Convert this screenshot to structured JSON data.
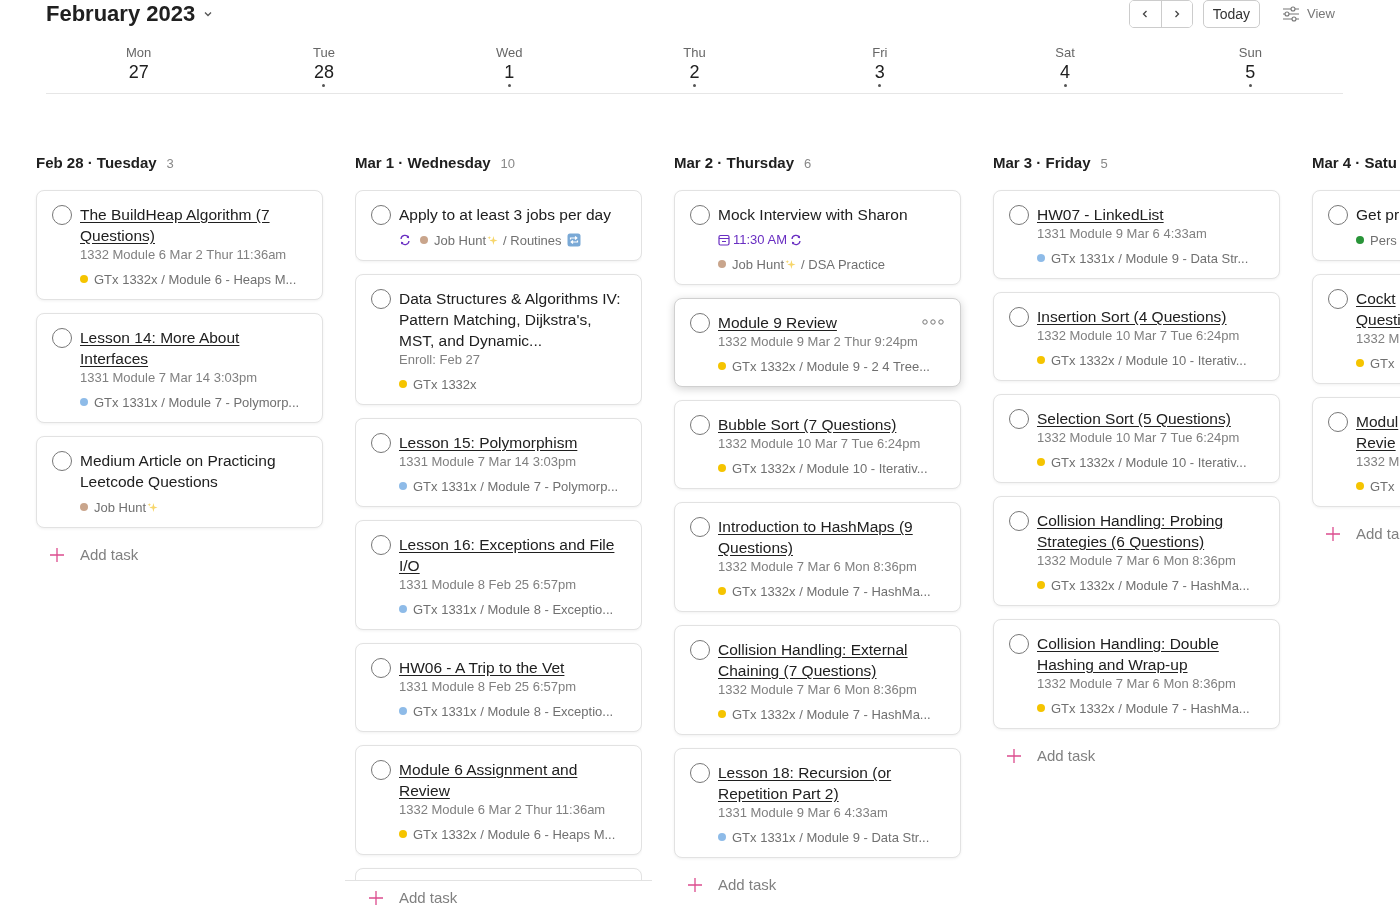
{
  "header": {
    "title": "February 2023",
    "nav": {
      "today": "Today",
      "view": "View"
    }
  },
  "week": [
    {
      "name": "Mon",
      "number": "27",
      "has_tasks": false
    },
    {
      "name": "Tue",
      "number": "28",
      "has_tasks": true
    },
    {
      "name": "Wed",
      "number": "1",
      "has_tasks": true
    },
    {
      "name": "Thu",
      "number": "2",
      "has_tasks": true
    },
    {
      "name": "Fri",
      "number": "3",
      "has_tasks": true
    },
    {
      "name": "Sat",
      "number": "4",
      "has_tasks": true
    },
    {
      "name": "Sun",
      "number": "5",
      "has_tasks": true
    }
  ],
  "columns": [
    {
      "heading": "Feb 28 · Tuesday",
      "count": "3",
      "scrolled": false,
      "add_task": "Add task",
      "tasks": [
        {
          "title": "The BuildHeap Algorithm (7 Questions)",
          "link": true,
          "completed": false,
          "hovered": false,
          "description": "1332 Module 6 Mar 2 Thur 11:36am",
          "project": {
            "name": "GTx 1332x / Module 6 - Heaps M...",
            "color": "#f5c400"
          }
        },
        {
          "title": "Lesson 14: More About Interfaces",
          "link": true,
          "completed": false,
          "hovered": false,
          "description": "1331 Module 7 Mar 14 3:03pm",
          "project": {
            "name": "GTx 1331x / Module 7 - Polymorp...",
            "color": "#8ebbe8"
          }
        },
        {
          "title": "Medium Article on Practicing Leetcode Questions",
          "link": false,
          "completed": false,
          "hovered": false,
          "project": {
            "name": "Job Hunt",
            "sparkle": true,
            "color": "#c9a58c"
          }
        }
      ]
    },
    {
      "heading": "Mar 1 · Wednesday",
      "count": "10",
      "scrolled": true,
      "add_task": "Add task",
      "tasks": [
        {
          "title": "Apply to at least 3 jobs per day",
          "link": false,
          "completed": false,
          "hovered": false,
          "recurring": true,
          "project": {
            "name": "Job Hunt",
            "sparkle": true,
            "section": "/ Routines",
            "section_icon": true,
            "color": "#c9a58c"
          }
        },
        {
          "title": "Data Structures & Algorithms IV: Pattern Matching, Dijkstra's, MST, and Dynamic...",
          "link": false,
          "completed": false,
          "hovered": false,
          "description": "Enroll: Feb 27",
          "project": {
            "name": "GTx 1332x",
            "color": "#f5c400"
          }
        },
        {
          "title": "Lesson 15: Polymorphism",
          "link": true,
          "completed": false,
          "hovered": false,
          "description": "1331 Module 7 Mar 14 3:03pm",
          "project": {
            "name": "GTx 1331x / Module 7 - Polymorp...",
            "color": "#8ebbe8"
          }
        },
        {
          "title": "Lesson 16: Exceptions and File I/O",
          "link": true,
          "completed": false,
          "hovered": false,
          "description": "1331 Module 8 Feb 25 6:57pm",
          "project": {
            "name": "GTx 1331x / Module 8 - Exceptio...",
            "color": "#8ebbe8"
          }
        },
        {
          "title": "HW06 - A Trip to the Vet",
          "link": true,
          "completed": false,
          "hovered": false,
          "description": "1331 Module 8 Feb 25 6:57pm",
          "project": {
            "name": "GTx 1331x / Module 8 - Exceptio...",
            "color": "#8ebbe8"
          }
        },
        {
          "title": "Module 6 Assignment and Review",
          "link": true,
          "completed": false,
          "hovered": false,
          "description": "1332 Module 6 Mar 2 Thur 11:36am",
          "project": {
            "name": "GTx 1332x / Module 6 - Heaps M...",
            "color": "#f5c400"
          }
        }
      ]
    },
    {
      "heading": "Mar 2 · Thursday",
      "count": "6",
      "scrolled": false,
      "add_task": "Add task",
      "tasks": [
        {
          "title": "Mock Interview with Sharon",
          "link": false,
          "completed": false,
          "hovered": false,
          "time": "11:30 AM",
          "recurring": true,
          "project": {
            "name": "Job Hunt",
            "sparkle": true,
            "section": "/ DSA Practice",
            "color": "#c9a58c"
          }
        },
        {
          "title": "Module 9 Review",
          "link": true,
          "completed": false,
          "hovered": true,
          "description": "1332 Module 9 Mar 2 Thur 9:24pm",
          "project": {
            "name": "GTx 1332x / Module 9 - 2 4 Tree...",
            "color": "#f5c400"
          }
        },
        {
          "title": "Bubble Sort (7 Questions)",
          "link": true,
          "completed": false,
          "hovered": false,
          "description": "1332 Module 10 Mar 7 Tue 6:24pm",
          "project": {
            "name": "GTx 1332x / Module 10 - Iterativ...",
            "color": "#f5c400"
          }
        },
        {
          "title": "Introduction to HashMaps (9 Questions)",
          "link": true,
          "completed": false,
          "hovered": false,
          "description": "1332 Module 7 Mar 6 Mon 8:36pm",
          "project": {
            "name": "GTx 1332x / Module 7 - HashMa...",
            "color": "#f5c400"
          }
        },
        {
          "title": "Collision Handling: External Chaining (7 Questions)",
          "link": true,
          "completed": false,
          "hovered": false,
          "description": "1332 Module 7 Mar 6 Mon 8:36pm",
          "project": {
            "name": "GTx 1332x / Module 7 - HashMa...",
            "color": "#f5c400"
          }
        },
        {
          "title": "Lesson 18: Recursion (or Repetition Part 2)",
          "link": true,
          "completed": false,
          "hovered": false,
          "description": "1331 Module 9 Mar 6 4:33am",
          "project": {
            "name": "GTx 1331x / Module 9 - Data Str...",
            "color": "#8ebbe8"
          }
        }
      ]
    },
    {
      "heading": "Mar 3 · Friday",
      "count": "5",
      "scrolled": false,
      "add_task": "Add task",
      "tasks": [
        {
          "title": "HW07 - LinkedList",
          "link": true,
          "completed": false,
          "hovered": false,
          "description": "1331 Module 9 Mar 6 4:33am",
          "project": {
            "name": "GTx 1331x / Module 9 - Data Str...",
            "color": "#8ebbe8"
          }
        },
        {
          "title": "Insertion Sort (4 Questions)",
          "link": true,
          "completed": false,
          "hovered": false,
          "description": "1332 Module 10 Mar 7 Tue 6:24pm",
          "project": {
            "name": "GTx 1332x / Module 10 - Iterativ...",
            "color": "#f5c400"
          }
        },
        {
          "title": "Selection Sort (5 Questions)",
          "link": true,
          "completed": false,
          "hovered": false,
          "description": "1332 Module 10 Mar 7 Tue 6:24pm",
          "project": {
            "name": "GTx 1332x / Module 10 - Iterativ...",
            "color": "#f5c400"
          }
        },
        {
          "title": "Collision Handling: Probing Strategies (6 Questions)",
          "link": true,
          "completed": false,
          "hovered": false,
          "description": "1332 Module 7 Mar 6 Mon 8:36pm",
          "project": {
            "name": "GTx 1332x / Module 7 - HashMa...",
            "color": "#f5c400"
          }
        },
        {
          "title": "Collision Handling: Double Hashing and Wrap-up",
          "link": true,
          "completed": false,
          "hovered": false,
          "description": "1332 Module 7 Mar 6 Mon 8:36pm",
          "project": {
            "name": "GTx 1332x / Module 7 - HashMa...",
            "color": "#f5c400"
          }
        }
      ]
    },
    {
      "heading": "Mar 4 · Satu",
      "scrolled": false,
      "add_task": "Add ta",
      "tasks": [
        {
          "title": "Get pr",
          "link": false,
          "completed": false,
          "hovered": false,
          "project": {
            "name": "Pers",
            "color": "#299438"
          }
        },
        {
          "title": "Cockt\nQuesti",
          "link": true,
          "completed": false,
          "hovered": false,
          "description": "1332 M",
          "project": {
            "name": "GTx",
            "color": "#f5c400"
          }
        },
        {
          "title": "Modul\nRevie",
          "link": true,
          "completed": false,
          "hovered": false,
          "description": "1332 M",
          "project": {
            "name": "GTx",
            "color": "#f5c400"
          }
        }
      ]
    }
  ]
}
